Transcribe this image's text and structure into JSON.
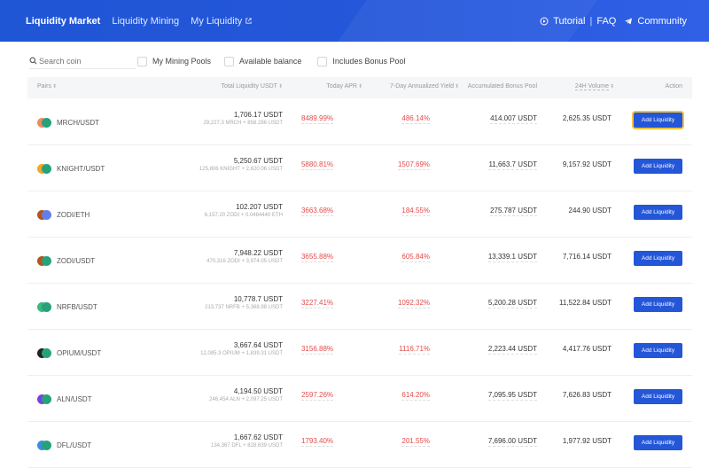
{
  "nav": {
    "left": [
      {
        "label": "Liquidity Market"
      },
      {
        "label": "Liquidity Mining"
      },
      {
        "label": "My Liquidity"
      }
    ],
    "tutorial": "Tutorial",
    "separator": "|",
    "faq": "FAQ",
    "community": "Community"
  },
  "filters": {
    "search_placeholder": "Search coin",
    "my_mining_pools": "My Mining Pools",
    "available_balance": "Available balance",
    "includes_bonus_pool": "Includes Bonus Pool"
  },
  "table": {
    "headers": {
      "pairs": "Pairs",
      "total_liquidity": "Total Liquidity USDT",
      "today_apr": "Today APR",
      "yield7": "7-Day Annualized Yield",
      "bonus_pool": "Accumulated Bonus Pool",
      "volume": "24H Volume",
      "action": "Action"
    },
    "rows": [
      {
        "pair": "MRCH/USDT",
        "total": "1,706.17 USDT",
        "sub": "29,227.3 MRCH + 858.286 USDT",
        "apr": "8489.99%",
        "yield": "486.14%",
        "bonus": "414.007 USDT",
        "volume": "2,625.35 USDT",
        "action": "Add Liquidity",
        "c1": "#f08a5d",
        "c2": "#26a17b"
      },
      {
        "pair": "KNIGHT/USDT",
        "total": "5,250.67 USDT",
        "sub": "125,806 KNIGHT + 2,620.06 USDT",
        "apr": "5880.81%",
        "yield": "1507.69%",
        "bonus": "11,663.7 USDT",
        "volume": "9,157.92 USDT",
        "action": "Add Liquidity",
        "c1": "#f5a623",
        "c2": "#26a17b"
      },
      {
        "pair": "ZODI/ETH",
        "total": "102.207 USDT",
        "sub": "6,157.20 ZODI + 0.0484440 ETH",
        "apr": "3663.68%",
        "yield": "184.55%",
        "bonus": "275.787 USDT",
        "volume": "244.90 USDT",
        "action": "Add Liquidity",
        "c1": "#b5541c",
        "c2": "#627eea"
      },
      {
        "pair": "ZODI/USDT",
        "total": "7,948.22 USDT",
        "sub": "470,316 ZODI + 3,974.05 USDT",
        "apr": "3655.88%",
        "yield": "605.84%",
        "bonus": "13,339.1 USDT",
        "volume": "7,716.14 USDT",
        "action": "Add Liquidity",
        "c1": "#b5541c",
        "c2": "#26a17b"
      },
      {
        "pair": "NRFB/USDT",
        "total": "10,778.7 USDT",
        "sub": "213,737 NRFB + 5,368.98 USDT",
        "apr": "3227.41%",
        "yield": "1092.32%",
        "bonus": "5,200.28 USDT",
        "volume": "11,522.84 USDT",
        "action": "Add Liquidity",
        "c1": "#3ab97a",
        "c2": "#26a17b"
      },
      {
        "pair": "OPIUM/USDT",
        "total": "3,667.64 USDT",
        "sub": "12,085.3 OPIUM + 1,839.31 USDT",
        "apr": "3156.88%",
        "yield": "1116.71%",
        "bonus": "2,223.44 USDT",
        "volume": "4,417.76 USDT",
        "action": "Add Liquidity",
        "c1": "#222222",
        "c2": "#26a17b"
      },
      {
        "pair": "ALN/USDT",
        "total": "4,194.50 USDT",
        "sub": "246,454 ALN + 2,097.25 USDT",
        "apr": "2597.26%",
        "yield": "614.20%",
        "bonus": "7,095.95 USDT",
        "volume": "7,626.83 USDT",
        "action": "Add Liquidity",
        "c1": "#7b3fe4",
        "c2": "#26a17b"
      },
      {
        "pair": "DFL/USDT",
        "total": "1,667.62 USDT",
        "sub": "134,367 DFL + 828.639 USDT",
        "apr": "1793.40%",
        "yield": "201.55%",
        "bonus": "7,696.00 USDT",
        "volume": "1,977.92 USDT",
        "action": "Add Liquidity",
        "c1": "#3b8de0",
        "c2": "#26a17b"
      }
    ]
  },
  "colors": {
    "brand": "#2456d8",
    "apr_red": "#e24b4b",
    "focus_ring": "#f5c23a"
  }
}
